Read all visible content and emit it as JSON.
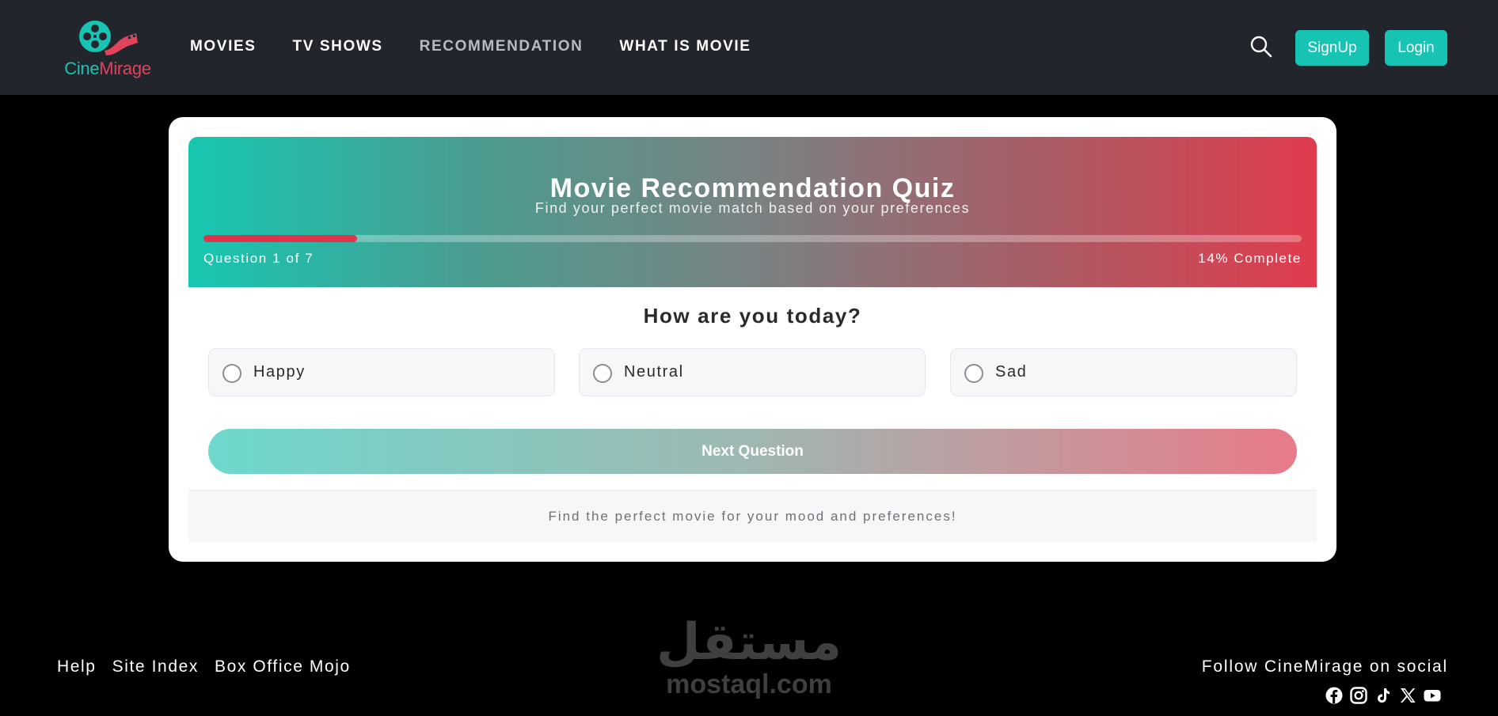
{
  "brand": {
    "name_part1": "Cine",
    "name_part2": "Mirage",
    "teal": "#17c3b2",
    "red": "#e0435a"
  },
  "nav": {
    "items": [
      {
        "label": "MOVIES",
        "active": false
      },
      {
        "label": "TV SHOWS",
        "active": false
      },
      {
        "label": "RECOMMENDATION",
        "active": true
      },
      {
        "label": "WHAT IS MOVIE",
        "active": false
      }
    ],
    "search_icon": "search-icon",
    "signup_label": "SignUp",
    "login_label": "Login"
  },
  "quiz": {
    "title": "Movie Recommendation Quiz",
    "subtitle": "Find your perfect movie match based on your preferences",
    "progress_percent": 14,
    "question_counter": "Question 1 of 7",
    "progress_text": "14% Complete",
    "question": "How are you today?",
    "options": [
      "Happy",
      "Neutral",
      "Sad"
    ],
    "next_label": "Next Question",
    "footer_text": "Find the perfect movie for your mood and preferences!"
  },
  "footer": {
    "links": [
      "Help",
      "Site Index",
      "Box Office Mojo"
    ],
    "follow_text": "Follow CineMirage on social",
    "socials": [
      "facebook-icon",
      "instagram-icon",
      "tiktok-icon",
      "x-icon",
      "youtube-icon"
    ]
  },
  "watermark": {
    "arabic": "مستقل",
    "latin": "mostaql.com"
  }
}
